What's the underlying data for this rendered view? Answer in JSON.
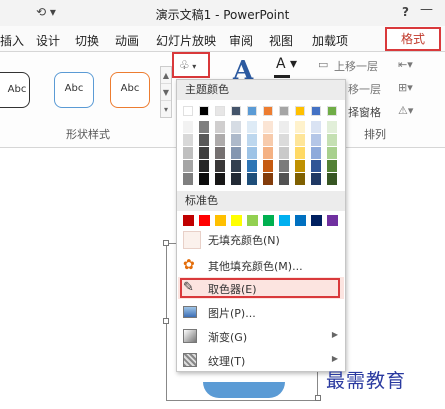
{
  "titlebar": {
    "qat": "&#x27F2; ▾",
    "title": "演示文稿1 - PowerPoint",
    "help": "?",
    "minimize": "—"
  },
  "tabs": [
    {
      "label": "插入"
    },
    {
      "label": "设计"
    },
    {
      "label": "切换"
    },
    {
      "label": "动画"
    },
    {
      "label": "幻灯片放映"
    },
    {
      "label": "审阅"
    },
    {
      "label": "视图"
    },
    {
      "label": "加载项"
    }
  ],
  "active_tab": "格式",
  "ribbon": {
    "shape_styles": [
      "Abc",
      "Abc",
      "Abc"
    ],
    "shape_styles_group": "形状样式",
    "arrange_group": "排列",
    "bring_forward": "上移一层",
    "send_backward": "移一层",
    "selection_pane": "择窗格"
  },
  "dropdown": {
    "theme_colors_label": "主题颜色",
    "standard_colors_label": "标准色",
    "theme_top_row": [
      "#ffffff",
      "#000000",
      "#e7e6e6",
      "#44546a",
      "#5b9bd5",
      "#ed7d31",
      "#a5a5a5",
      "#ffc000",
      "#4472c4",
      "#70ad47"
    ],
    "theme_shades": [
      [
        "#f2f2f2",
        "#7f7f7f",
        "#d0cece",
        "#d6dce4",
        "#deebf6",
        "#fbe5d5",
        "#ededed",
        "#fff2cc",
        "#dae3f3",
        "#e2efd9"
      ],
      [
        "#d8d8d8",
        "#595959",
        "#aeabab",
        "#adb9ca",
        "#bdd7ee",
        "#f7cbac",
        "#dbdbdb",
        "#fee599",
        "#b4c6e7",
        "#c5e0b3"
      ],
      [
        "#bfbfbf",
        "#3f3f3f",
        "#757070",
        "#8496b0",
        "#9dc3e6",
        "#f4b183",
        "#c9c9c9",
        "#ffd965",
        "#8eaadb",
        "#a8d08d"
      ],
      [
        "#a5a5a5",
        "#262626",
        "#3a3838",
        "#323f4f",
        "#2e75b5",
        "#c55a11",
        "#7b7b7b",
        "#bf9000",
        "#2f5496",
        "#538135"
      ],
      [
        "#7f7f7f",
        "#0c0c0c",
        "#171616",
        "#222a35",
        "#1e4e79",
        "#833c0b",
        "#525252",
        "#7f6000",
        "#1f3864",
        "#375623"
      ]
    ],
    "standard_colors": [
      "#c00000",
      "#ff0000",
      "#ffc000",
      "#ffff00",
      "#92d050",
      "#00b050",
      "#00b0f0",
      "#0070c0",
      "#002060",
      "#7030a0"
    ],
    "items": [
      {
        "label": "无填充颜色(N)"
      },
      {
        "label": "其他填充颜色(M)..."
      },
      {
        "label": "取色器(E)"
      },
      {
        "label": "图片(P)..."
      },
      {
        "label": "渐变(G)"
      },
      {
        "label": "纹理(T)"
      }
    ]
  },
  "watermark": "最需教育"
}
